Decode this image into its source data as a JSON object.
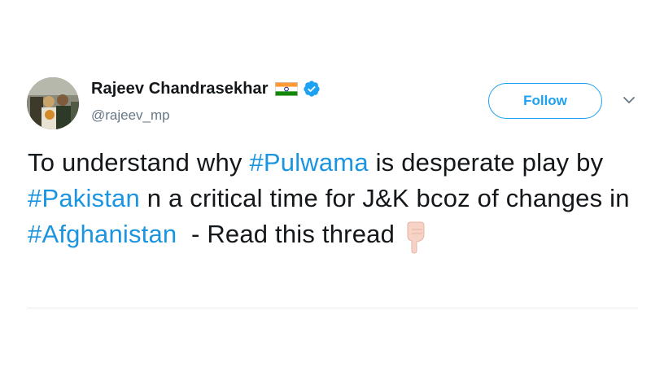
{
  "author": {
    "display_name": "Rajeev Chandrasekhar",
    "handle": "@rajeev_mp",
    "flag_icon": "india-flag-icon",
    "verified_icon": "verified-badge-icon"
  },
  "actions": {
    "follow_label": "Follow",
    "menu_icon": "chevron-down-icon"
  },
  "tweet": {
    "segments": [
      {
        "text": "To understand why ",
        "type": "text"
      },
      {
        "text": "#Pulwama",
        "type": "hashtag"
      },
      {
        "text": " is desperate play by ",
        "type": "text"
      },
      {
        "text": "#Pakistan",
        "type": "hashtag"
      },
      {
        "text": " n a critical time for J&K bcoz of changes in ",
        "type": "text"
      },
      {
        "text": "#Afghanistan",
        "type": "hashtag"
      },
      {
        "text": "  - Read this thread",
        "type": "text"
      }
    ],
    "emoji_icon": "backhand-index-pointing-down-icon"
  },
  "colors": {
    "link": "#1b95e0",
    "accent": "#1da1f2",
    "text": "#14171a",
    "secondary": "#657786"
  }
}
